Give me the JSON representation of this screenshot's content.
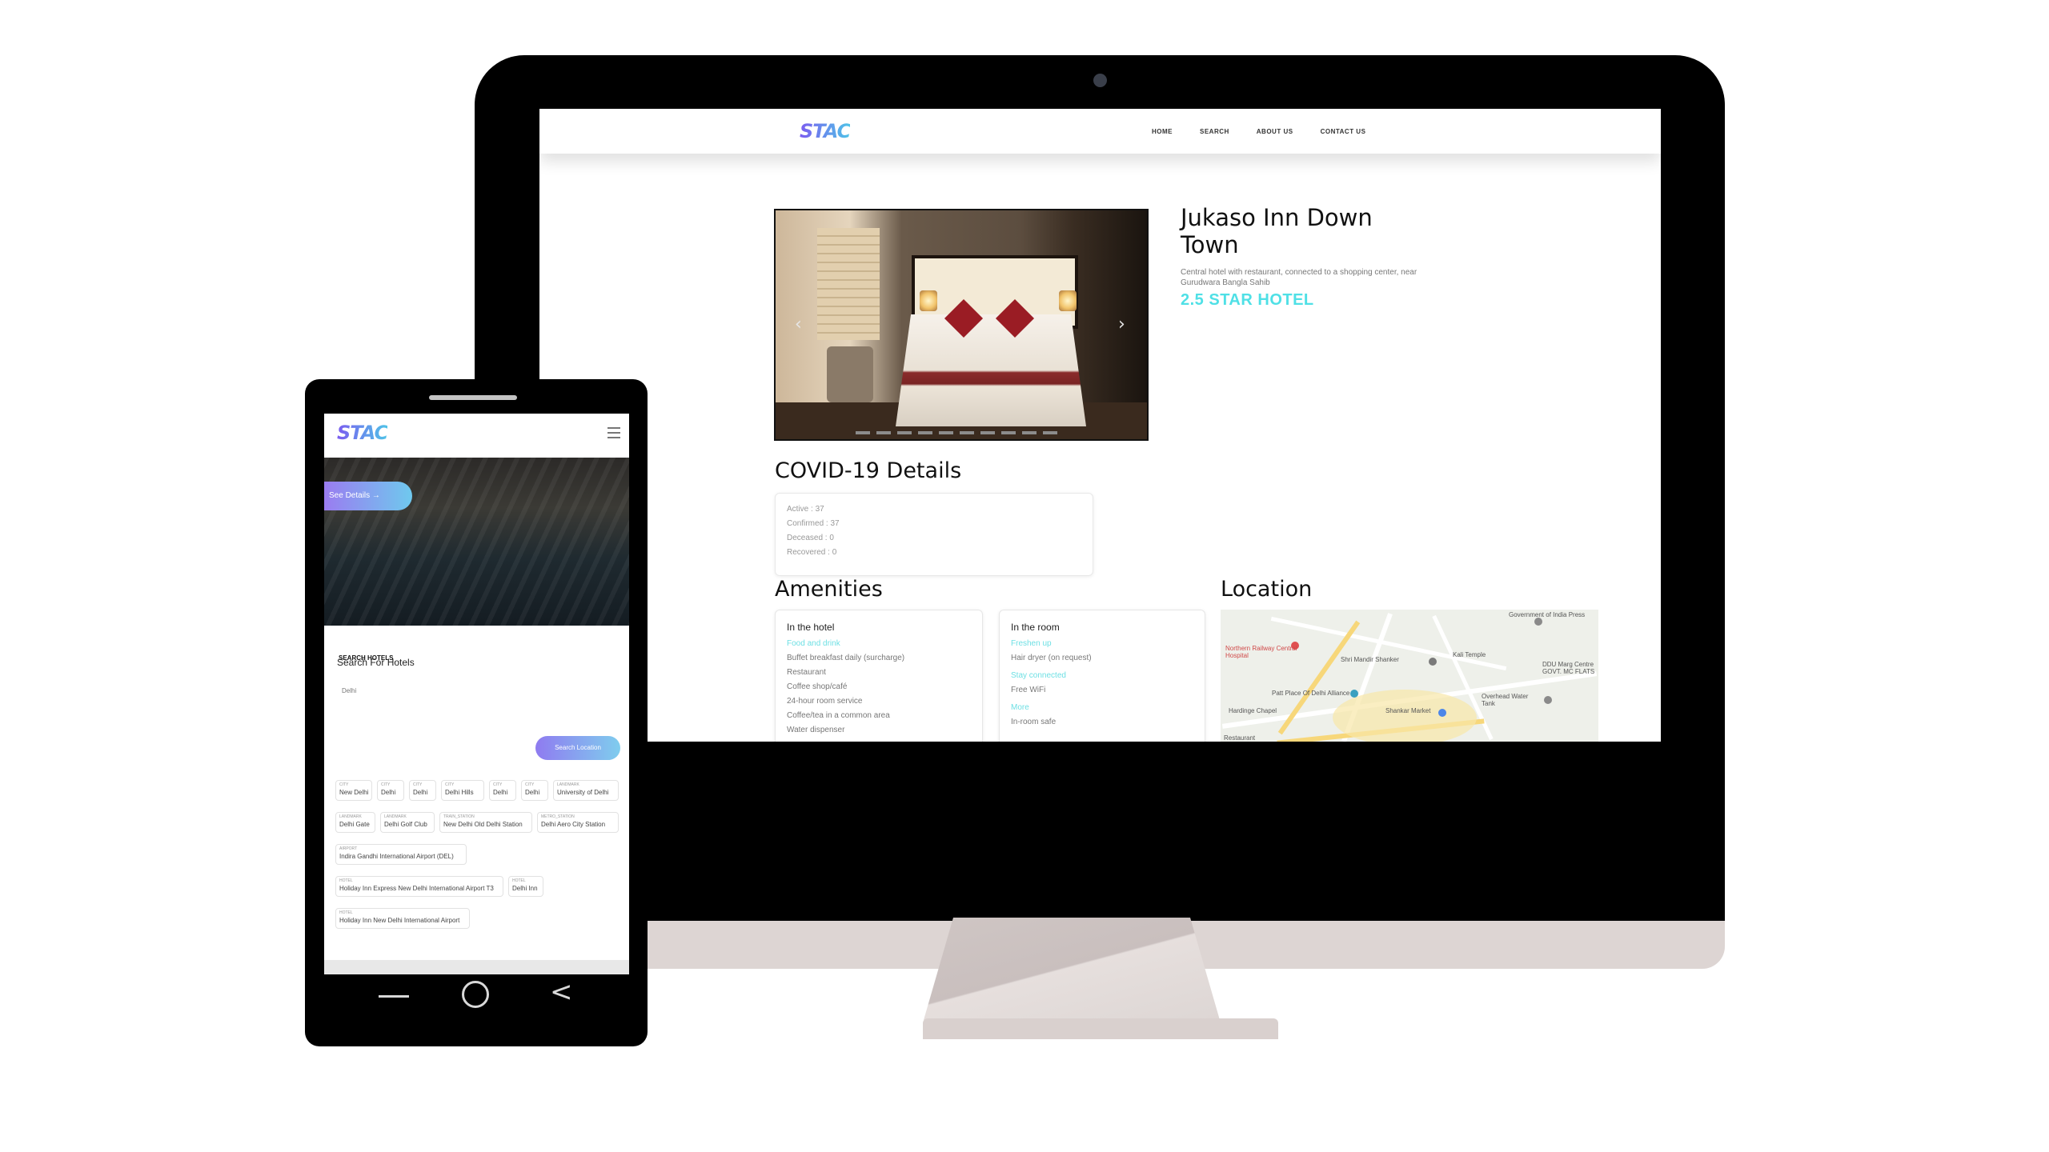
{
  "desktop": {
    "brand": "STAC",
    "nav": [
      "HOME",
      "SEARCH",
      "ABOUT US",
      "CONTACT US"
    ],
    "hotel": {
      "name": "Jukaso Inn Down Town",
      "description": "Central hotel with restaurant, connected to a shopping center, near Gurudwara Bangla Sahib",
      "rating": "2.5 STAR HOTEL"
    },
    "covid": {
      "title": "COVID-19 Details",
      "lines": [
        "Active : 37",
        "Confirmed : 37",
        "Deceased : 0",
        "Recovered : 0"
      ]
    },
    "amenities": {
      "title": "Amenities",
      "in_hotel": {
        "heading": "In the hotel",
        "items": [
          "Food and drink",
          "Buffet breakfast daily (surcharge)",
          "Restaurant",
          "Coffee shop/café",
          "24-hour room service",
          "Coffee/tea in a common area",
          "Water dispenser"
        ]
      },
      "in_room": {
        "heading": "In the room",
        "items": [
          "Freshen up",
          "Hair dryer (on request)",
          "Stay connected",
          "Free WiFi",
          "More",
          "In-room safe"
        ]
      }
    },
    "location": {
      "title": "Location",
      "labels": [
        "Government of India Press",
        "Northern Railway Central Hospital",
        "Shri Mandir Shanker",
        "Kali Temple",
        "DDU Marg Centre GOVT. MC FLATS",
        "Patt Place Of Delhi Alliance",
        "Overhead Water Tank",
        "Shankar Market",
        "Hardinge Chapel",
        "Restaurant"
      ]
    }
  },
  "mobile": {
    "brand": "STAC",
    "see_details": "See Details  →",
    "tab": "SEARCH HOTELS",
    "search_title": "Search For Hotels",
    "search_value": "Delhi",
    "search_button": "Search Location",
    "chips": [
      {
        "type": "CITY",
        "value": "New Delhi"
      },
      {
        "type": "CITY",
        "value": "Delhi"
      },
      {
        "type": "CITY",
        "value": "Delhi"
      },
      {
        "type": "CITY",
        "value": "Delhi Hills"
      },
      {
        "type": "CITY",
        "value": "Delhi"
      },
      {
        "type": "CITY",
        "value": "Delhi"
      },
      {
        "type": "LANDMARK",
        "value": "University of Delhi"
      },
      {
        "type": "LANDMARK",
        "value": "Delhi Gate"
      },
      {
        "type": "LANDMARK",
        "value": "Delhi Golf Club"
      },
      {
        "type": "TRAIN_STATION",
        "value": "New Delhi Old Delhi Station"
      },
      {
        "type": "METRO_STATION",
        "value": "Delhi Aero City Station"
      },
      {
        "type": "AIRPORT",
        "value": "Indira Gandhi International Airport (DEL)"
      },
      {
        "type": "HOTEL",
        "value": "Holiday Inn Express New Delhi International Airport T3"
      },
      {
        "type": "HOTEL",
        "value": "Delhi Inn"
      },
      {
        "type": "HOTEL",
        "value": "Holiday Inn New Delhi International Airport"
      }
    ]
  },
  "colors": {
    "accent": "#7b5cf0",
    "teal": "#4fe0e6",
    "monitor_chin": "#ddd5d3"
  }
}
